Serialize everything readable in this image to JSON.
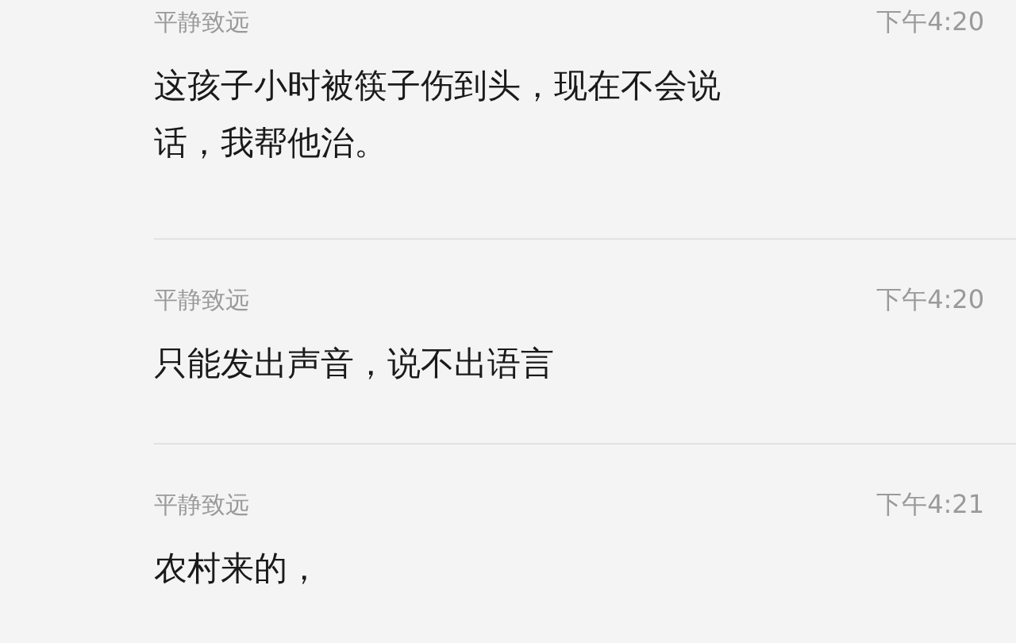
{
  "messages": [
    {
      "sender": "平静致远",
      "time": "下午4:20",
      "text": "这孩子小时被筷子伤到头，现在不会说话，我帮他治。"
    },
    {
      "sender": "平静致远",
      "time": "下午4:20",
      "text": "只能发出声音，说不出语言"
    },
    {
      "sender": "平静致远",
      "time": "下午4:21",
      "text": "农村来的，"
    }
  ]
}
